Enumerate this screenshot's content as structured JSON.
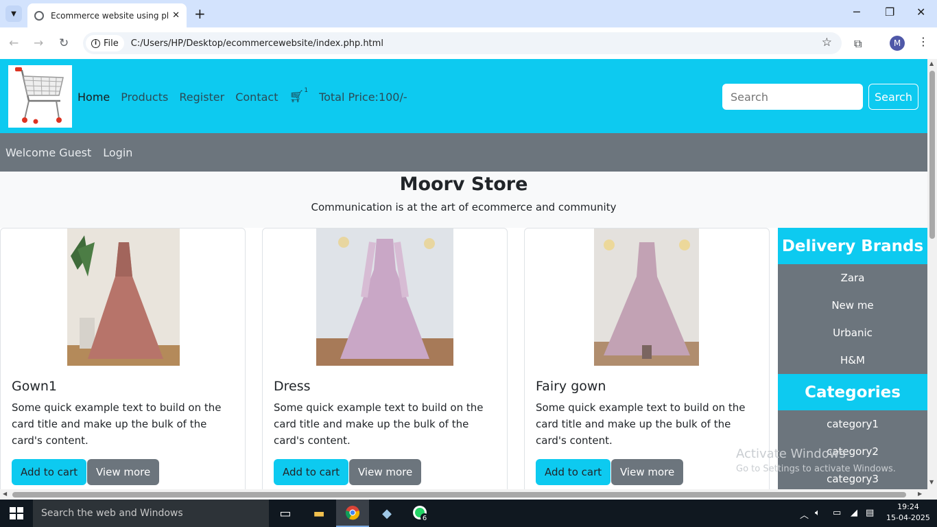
{
  "browser": {
    "tab_title": "Ecommerce website using php",
    "scheme_label": "File",
    "url": "C:/Users/HP/Desktop/ecommercewebsite/index.php.html",
    "profile_initial": "M"
  },
  "navbar": {
    "links": [
      "Home",
      "Products",
      "Register",
      "Contact"
    ],
    "cart_count": "1",
    "total_price": "Total Price:100/-",
    "search_placeholder": "Search",
    "search_button": "Search"
  },
  "userbar": {
    "welcome": "Welcome Guest",
    "login": "Login"
  },
  "hero": {
    "title": "Moorv Store",
    "subtitle": "Communication is at the art of ecommerce and community"
  },
  "products": [
    {
      "title": "Gown1",
      "text": "Some quick example text to build on the card title and make up the bulk of the card's content.",
      "add": "Add to cart",
      "view": "View more"
    },
    {
      "title": "Dress",
      "text": "Some quick example text to build on the card title and make up the bulk of the card's content.",
      "add": "Add to cart",
      "view": "View more"
    },
    {
      "title": "Fairy gown",
      "text": "Some quick example text to build on the card title and make up the bulk of the card's content.",
      "add": "Add to cart",
      "view": "View more"
    }
  ],
  "sidebar": {
    "brands_title": "Delivery Brands",
    "brands": [
      "Zara",
      "New me",
      "Urbanic",
      "H&M"
    ],
    "categories_title": "Categories",
    "categories": [
      "category1",
      "category2",
      "category3"
    ]
  },
  "watermark": {
    "line1": "Activate Windows",
    "line2": "Go to Settings to activate Windows."
  },
  "taskbar": {
    "search": "Search the web and Windows",
    "time": "19:24",
    "date": "15-04-2025",
    "badge": "6"
  },
  "colors": {
    "accent": "#0dcaf0",
    "secondary": "#6c757d"
  }
}
